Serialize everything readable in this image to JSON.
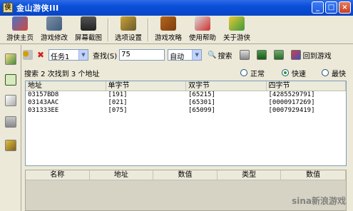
{
  "window": {
    "title": "金山游侠III",
    "icon_char": "侠"
  },
  "toolbar": {
    "items": [
      {
        "label": "游侠主页"
      },
      {
        "label": "游戏修改"
      },
      {
        "label": "屏幕截图"
      },
      {
        "label": "选项设置"
      },
      {
        "label": "游戏攻略"
      },
      {
        "label": "使用帮助"
      },
      {
        "label": "关于游侠"
      }
    ]
  },
  "search": {
    "task_select": "任务1",
    "find_label": "查找(S)",
    "find_value": "75",
    "type_select": "自动",
    "search_button": "搜索",
    "back_to_game": "回到游戏"
  },
  "status": {
    "text": "搜索 2 次找到 3 个地址",
    "radio_normal": "正常",
    "radio_fast": "快速",
    "radio_slow": "最快",
    "selected": "fast"
  },
  "results": {
    "columns": [
      "地址",
      "单字节",
      "双字节",
      "四字节"
    ],
    "rows": [
      [
        "03157BD8",
        "[191]",
        "[65215]",
        "[4285529791]"
      ],
      [
        "03143AAC",
        "[021]",
        "[65301]",
        "[0000917269]"
      ],
      [
        "031333EE",
        "[075]",
        "[65099]",
        "[0007929419]"
      ]
    ]
  },
  "lower_table": {
    "columns": [
      "名称",
      "地址",
      "数值",
      "类型",
      "数值"
    ]
  },
  "watermark": "sina新浪游戏"
}
